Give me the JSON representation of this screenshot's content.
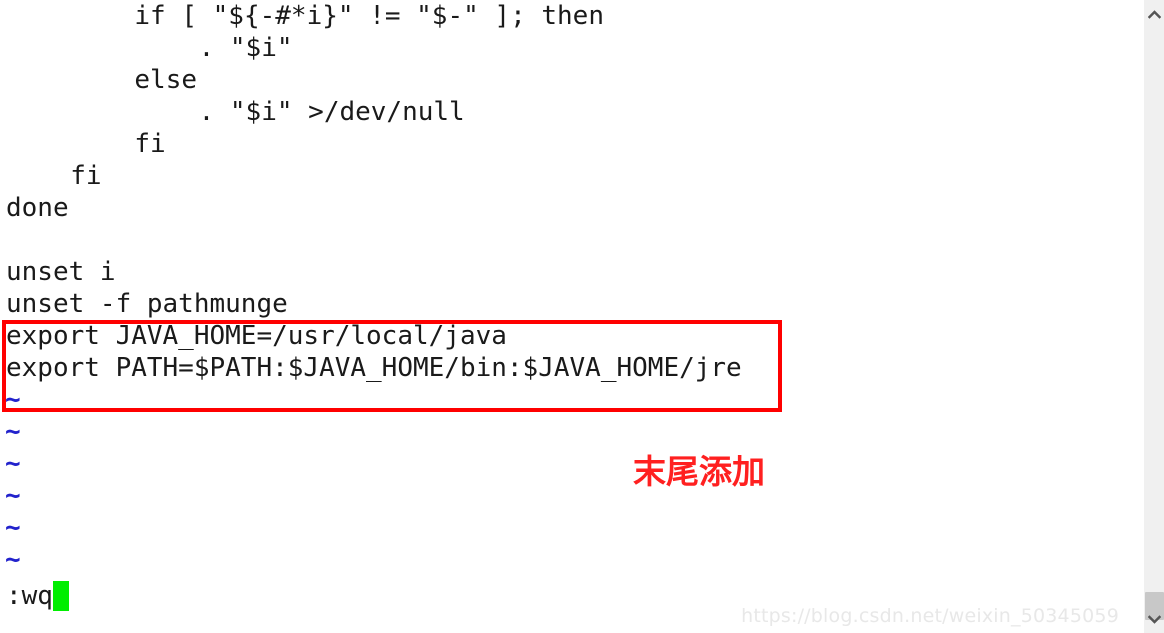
{
  "editor": {
    "name": "vim",
    "background_color": "#ffffff",
    "text_color": "#1a1a1a",
    "tilde_color": "#2222cc",
    "code_lines": [
      {
        "indent": 8,
        "text": "if [ \"${-#*i}\" != \"$-\" ]; then"
      },
      {
        "indent": 12,
        "text": ". \"$i\""
      },
      {
        "indent": 8,
        "text": "else"
      },
      {
        "indent": 12,
        "text": ". \"$i\" >/dev/null"
      },
      {
        "indent": 8,
        "text": "fi"
      },
      {
        "indent": 4,
        "text": "fi"
      },
      {
        "indent": 0,
        "text": "done"
      },
      {
        "indent": 0,
        "text": ""
      },
      {
        "indent": 0,
        "text": "unset i"
      },
      {
        "indent": 0,
        "text": "unset -f pathmunge"
      },
      {
        "indent": 0,
        "text": "export JAVA_HOME=/usr/local/java"
      },
      {
        "indent": 0,
        "text": "export PATH=$PATH:$JAVA_HOME/bin:$JAVA_HOME/jre"
      }
    ],
    "tilde_lines": [
      "~",
      "~",
      "~",
      "~",
      "~",
      "~"
    ],
    "command_line": {
      "text": ":wq",
      "cursor_color": "#00ee00"
    }
  },
  "annotations": {
    "highlight_box": {
      "color": "#ff0000",
      "label": "red-rectangle-around-export-lines"
    },
    "note": {
      "text": "末尾添加",
      "color": "#ff2020"
    }
  },
  "scrollbar": {
    "up_arrow": "chevron-up-icon",
    "down_arrow": "chevron-down-icon",
    "track_color": "#f0f0f0",
    "thumb_color": "#c8c8c8"
  },
  "watermark": {
    "text": "https://blog.csdn.net/weixin_50345059"
  }
}
